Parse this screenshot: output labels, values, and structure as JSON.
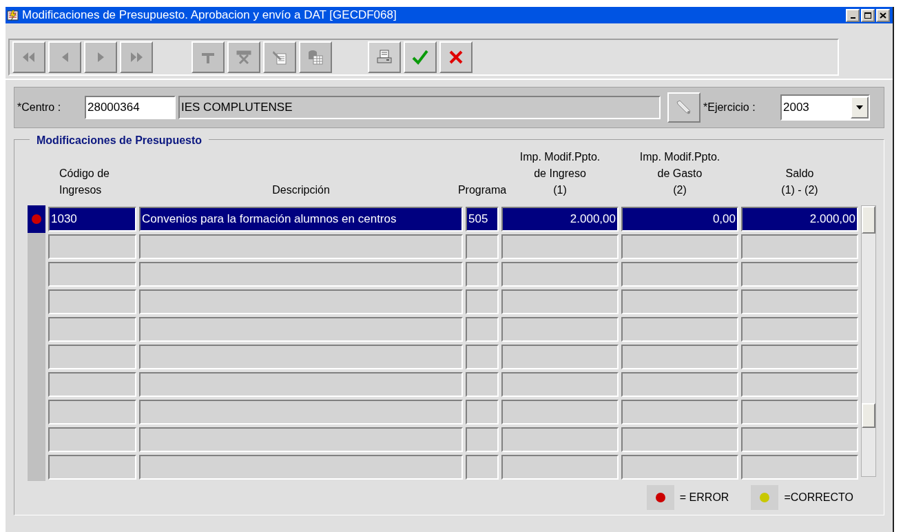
{
  "window": {
    "title": "Modificaciones de Presupuesto. Aprobacion y envío a DAT [GECDF068]"
  },
  "toolbar": {
    "buttons": [
      {
        "kind": "first",
        "disabled": true
      },
      {
        "kind": "previous",
        "disabled": true
      },
      {
        "kind": "next",
        "disabled": true
      },
      {
        "kind": "last",
        "disabled": true
      },
      {
        "kind": "insert",
        "disabled": true
      },
      {
        "kind": "delete",
        "disabled": true
      },
      {
        "kind": "edit",
        "disabled": true
      },
      {
        "kind": "database",
        "disabled": true
      },
      {
        "kind": "print",
        "disabled": false
      },
      {
        "kind": "accept",
        "disabled": false
      },
      {
        "kind": "cancel",
        "disabled": false
      }
    ]
  },
  "centro": {
    "label": "*Centro :",
    "code": "28000364",
    "name": "IES COMPLUTENSE"
  },
  "ejercicio": {
    "label": "*Ejercicio :",
    "value": "2003"
  },
  "group": {
    "title": "Modificaciones de Presupuesto",
    "columns": [
      {
        "lines": [
          "Código de",
          "Ingresos"
        ]
      },
      {
        "lines": [
          "Descripción"
        ]
      },
      {
        "lines": [
          "Programa"
        ]
      },
      {
        "lines": [
          "Imp. Modif.Ppto.",
          "de Ingreso",
          "(1)"
        ]
      },
      {
        "lines": [
          "Imp. Modif.Ppto.",
          "de Gasto",
          "(2)"
        ]
      },
      {
        "lines": [
          "Saldo",
          "(1) - (2)"
        ]
      }
    ],
    "rows": [
      {
        "selected": true,
        "color": "#cc0000",
        "cells": [
          "1030",
          "Convenios para la formación alumnos en centros",
          "505",
          "2.000,00",
          "0,00",
          "2.000,00"
        ]
      }
    ],
    "legend": [
      {
        "color": "#cc0000",
        "label": "= ERROR"
      },
      {
        "color": "#c8c800",
        "label": "=CORRECTO"
      }
    ]
  }
}
